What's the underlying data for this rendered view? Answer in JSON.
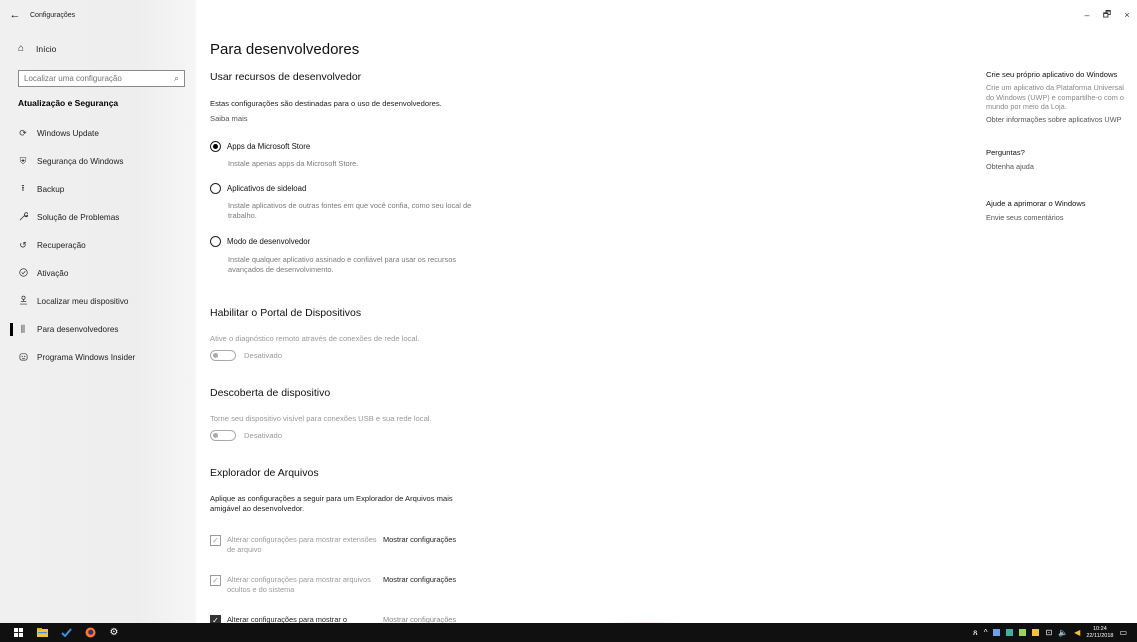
{
  "window": {
    "title": "Configurações",
    "back_glyph": "←",
    "controls": {
      "minimize": "–",
      "restore": "🗗",
      "close": "×"
    }
  },
  "sidebar": {
    "home_label": "Início",
    "search_placeholder": "Localizar uma configuração",
    "section_title": "Atualização e Segurança",
    "items": [
      {
        "label": "Windows Update",
        "icon": "refresh-icon",
        "glyph": "⟳"
      },
      {
        "label": "Segurança do Windows",
        "icon": "shield-icon",
        "glyph": "⛨"
      },
      {
        "label": "Backup",
        "icon": "backup-arrow-icon",
        "glyph": "⭱"
      },
      {
        "label": "Solução de Problemas",
        "icon": "wrench-icon",
        "glyph": "🔧"
      },
      {
        "label": "Recuperação",
        "icon": "recovery-icon",
        "glyph": "↺"
      },
      {
        "label": "Ativação",
        "icon": "check-circle-icon",
        "glyph": "⊘"
      },
      {
        "label": "Localizar meu dispositivo",
        "icon": "person-location-icon",
        "glyph": "⚲"
      },
      {
        "label": "Para desenvolvedores",
        "icon": "developer-sliders-icon",
        "glyph": "⫼",
        "active": true
      },
      {
        "label": "Programa Windows Insider",
        "icon": "insider-icon",
        "glyph": "☺"
      }
    ]
  },
  "main": {
    "title": "Para desenvolvedores",
    "dev_section": {
      "heading": "Usar recursos de desenvolvedor",
      "description": "Estas configurações são destinadas para o uso de desenvolvedores.",
      "learn_more": "Saiba mais",
      "options": [
        {
          "label": "Apps da Microsoft Store",
          "desc": "Instale apenas apps da Microsoft Store.",
          "selected": true
        },
        {
          "label": "Aplicativos de sideload",
          "desc": "Instale aplicativos de outras fontes em que você confia, como seu local de trabalho.",
          "selected": false
        },
        {
          "label": "Modo de desenvolvedor",
          "desc": "Instale qualquer aplicativo assinado e confiável para usar os recursos avançados de desenvolvimento.",
          "selected": false
        }
      ]
    },
    "portal": {
      "heading": "Habilitar o Portal de Dispositivos",
      "description": "Ative o diagnóstico remoto através de conexões de rede local.",
      "toggle_state": "Desativado"
    },
    "discovery": {
      "heading": "Descoberta de dispositivo",
      "description": "Torne seu dispositivo visível para conexões USB e sua rede local.",
      "toggle_state": "Desativado"
    },
    "explorer": {
      "heading": "Explorador de Arquivos",
      "description": "Aplique as configurações a seguir para um Explorador de Arquivos mais amigável ao desenvolvedor.",
      "items": [
        {
          "label": "Alterar configurações para mostrar extensões de arquivo",
          "link": "Mostrar configurações"
        },
        {
          "label": "Alterar configurações para mostrar arquivos ocultos e do sistema",
          "link": "Mostrar configurações"
        },
        {
          "label": "Alterar configurações para mostrar o",
          "link": "Mostrar configurações"
        }
      ]
    }
  },
  "right_panel": {
    "create_title": "Crie seu próprio aplicativo do Windows",
    "create_desc": "Crie um aplicativo da Plataforma Universal do Windows (UWP) e compartilhe-o com o mundo por meio da Loja.",
    "create_link": "Obter informações sobre aplicativos UWP",
    "questions_title": "Perguntas?",
    "questions_link": "Obtenha ajuda",
    "improve_title": "Ajude a aprimorar o Windows",
    "improve_link": "Envie seus comentários"
  },
  "taskbar": {
    "time": "10:24",
    "date": "22/11/2018",
    "colors": {
      "background": "#101010",
      "start": "#ffffff",
      "explorer": "#f2c23c",
      "todo": "#3a8ee6",
      "firefox": "#ff7a1a"
    }
  }
}
